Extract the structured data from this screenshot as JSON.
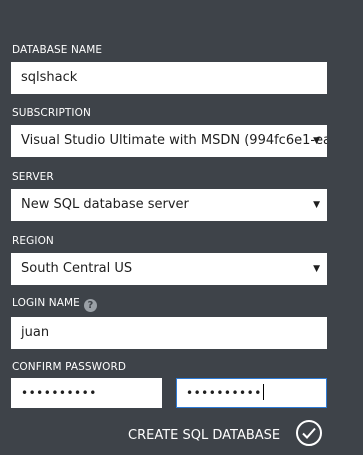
{
  "form": {
    "database_name": {
      "label": "DATABASE NAME",
      "value": "sqlshack"
    },
    "subscription": {
      "label": "SUBSCRIPTION",
      "value": "Visual Studio Ultimate with MSDN (994fc6e1-ea"
    },
    "server": {
      "label": "SERVER",
      "value": "New SQL database server"
    },
    "region": {
      "label": "REGION",
      "value": "South Central US"
    },
    "login_name": {
      "label": "LOGIN NAME",
      "value": "juan",
      "help_glyph": "?"
    },
    "password": {
      "label": "CONFIRM PASSWORD",
      "password_mask": "••••••••••",
      "confirm_mask": "••••••••••"
    },
    "submit": {
      "label": "CREATE SQL DATABASE",
      "icon": "checkmark-circle-icon"
    }
  },
  "icons": {
    "dropdown_caret": "▼",
    "help": "help-icon"
  },
  "colors": {
    "panel_background": "#3e4349",
    "field_background": "#ffffff",
    "focus_border": "#2e7bd6",
    "label_text": "#ffffff"
  }
}
